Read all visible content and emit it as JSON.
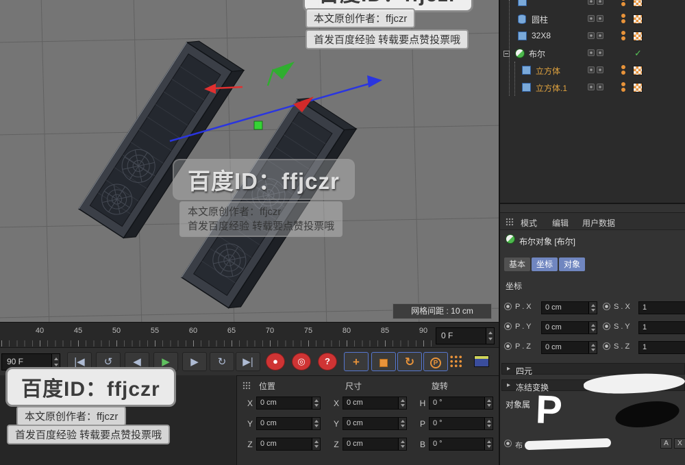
{
  "watermarks": {
    "id_text": "百度ID：ffjczr",
    "author_line": "本文原创作者：ffjczr",
    "credit_line": "首发百度经验 转载要点赞投票哦"
  },
  "viewport": {
    "grid_spacing_label": "网格间距 : 10 cm"
  },
  "object_manager": {
    "items": [
      {
        "name": "圆柱"
      },
      {
        "name": "32X8"
      },
      {
        "name": "布尔"
      },
      {
        "name": "立方体"
      },
      {
        "name": "立方体.1"
      }
    ]
  },
  "attributes": {
    "menu": [
      "模式",
      "编辑",
      "用户数据"
    ],
    "title": "布尔对象 [布尔]",
    "tabs": [
      "基本",
      "坐标",
      "对象"
    ],
    "coord_section": "坐标",
    "rows": [
      {
        "p_label": "P . X",
        "p_value": "0 cm",
        "s_label": "S . X",
        "s_value": "1"
      },
      {
        "p_label": "P . Y",
        "p_value": "0 cm",
        "s_label": "S . Y",
        "s_value": "1"
      },
      {
        "p_label": "P . Z",
        "p_value": "0 cm",
        "s_label": "S . Z",
        "s_value": "1"
      }
    ],
    "quaternion_section": "四元",
    "freeze_section": "冻结变换",
    "object_props_section": "对象属",
    "bool_label": "布",
    "button_a": "A",
    "button_x": "X",
    "scribble_letter": "P"
  },
  "timeline": {
    "ticks": [
      "40",
      "45",
      "50",
      "55",
      "60",
      "65",
      "70",
      "75",
      "80",
      "85",
      "90"
    ],
    "current_frame": "0 F",
    "end_frame": "90 F"
  },
  "icons": {
    "jump_start": "|◀",
    "loop_back": "↺",
    "step_back": "◀",
    "play": "▶",
    "step_forward": "▶",
    "loop": "↻",
    "jump_end": "▶|",
    "record": "●",
    "autokey": "◎",
    "help": "?",
    "move": "+",
    "rotate": "↻",
    "p_tool": "P",
    "chevron": "▸",
    "check": "✓"
  },
  "coord_panel": {
    "headers": {
      "position": "位置",
      "size": "尺寸",
      "rotation": "旋转"
    },
    "rows": [
      {
        "pl": "X",
        "pv": "0 cm",
        "sl": "X",
        "sv": "0 cm",
        "rl": "H",
        "rv": "0 °"
      },
      {
        "pl": "Y",
        "pv": "0 cm",
        "sl": "Y",
        "sv": "0 cm",
        "rl": "P",
        "rv": "0 °"
      },
      {
        "pl": "Z",
        "pv": "0 cm",
        "sl": "Z",
        "sv": "0 cm",
        "rl": "B",
        "rv": "0 °"
      }
    ]
  }
}
